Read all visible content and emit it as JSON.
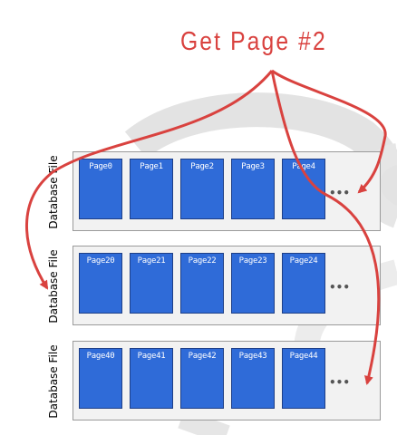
{
  "title": "Get Page #2",
  "colors": {
    "accent": "#d9423f",
    "page": "#2f6bd8",
    "file_bg": "#f2f2f2"
  },
  "files": [
    {
      "label": "Database File",
      "pages": [
        "Page0",
        "Page1",
        "Page2",
        "Page3",
        "Page4"
      ],
      "more": "•••"
    },
    {
      "label": "Database File",
      "pages": [
        "Page20",
        "Page21",
        "Page22",
        "Page23",
        "Page24"
      ],
      "more": "•••"
    },
    {
      "label": "Database File",
      "pages": [
        "Page40",
        "Page41",
        "Page42",
        "Page43",
        "Page44"
      ],
      "more": "•••"
    }
  ]
}
